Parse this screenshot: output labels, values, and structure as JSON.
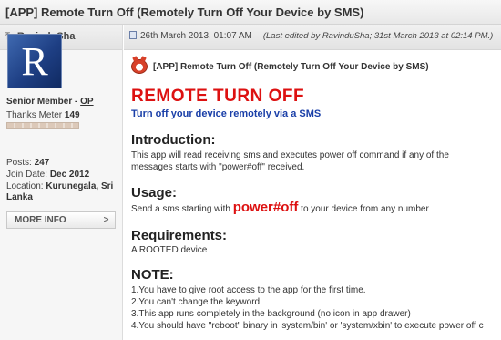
{
  "thread": {
    "title": "[APP] Remote Turn Off (Remotely Turn Off Your Device by SMS)"
  },
  "user": {
    "arrow_icon": "up-arrow-icon",
    "username": "RavinduSha",
    "avatar_letter": "R",
    "rank": "Senior Member - ",
    "op": "OP",
    "thanks_label": "Thanks Meter ",
    "thanks_value": "149",
    "thanks_meter_fraction": 1.0,
    "posts_label": "Posts: ",
    "posts": "247",
    "join_label": "Join Date: ",
    "join_date": "Dec 2012",
    "location_label": "Location: ",
    "location_line1": "Kurunegala, Sri",
    "location_line2": "Lanka",
    "more_info": "MORE INFO",
    "more_info_chevron": ">"
  },
  "post": {
    "doc_icon": "document-icon",
    "date": "26th March 2013, 01:07 AM",
    "edited": "(Last edited by RavinduSha; 31st March 2013 at 02:14 PM.)",
    "app_icon": "android-app-icon",
    "subtitle": "[APP] Remote Turn Off (Remotely Turn Off Your Device by SMS)",
    "headline": "REMOTE TURN OFF",
    "tagline": "Turn off your device remotely via a SMS",
    "intro_title": "Introduction:",
    "intro_line1": "This app will read receiving sms and executes power off command if any of the",
    "intro_line2": "messages starts with \"power#off\" received.",
    "usage_title": "Usage:",
    "usage_before": "Send a sms starting with ",
    "usage_keyword": "power#off",
    "usage_after": " to your device from any number",
    "req_title": "Requirements:",
    "req_text": "A ROOTED device",
    "note_title": "NOTE:",
    "notes": [
      "1.You have to give root access to the app for the first time.",
      "2.You can't change the keyword.",
      "3.This app runs completely in the background (no icon in app drawer)",
      "4.You should have \"reboot\" binary in 'system/bin' or 'system/xbin' to execute power off c"
    ]
  },
  "colors": {
    "headline": "#dd1111",
    "tagline": "#1a3fa8"
  }
}
